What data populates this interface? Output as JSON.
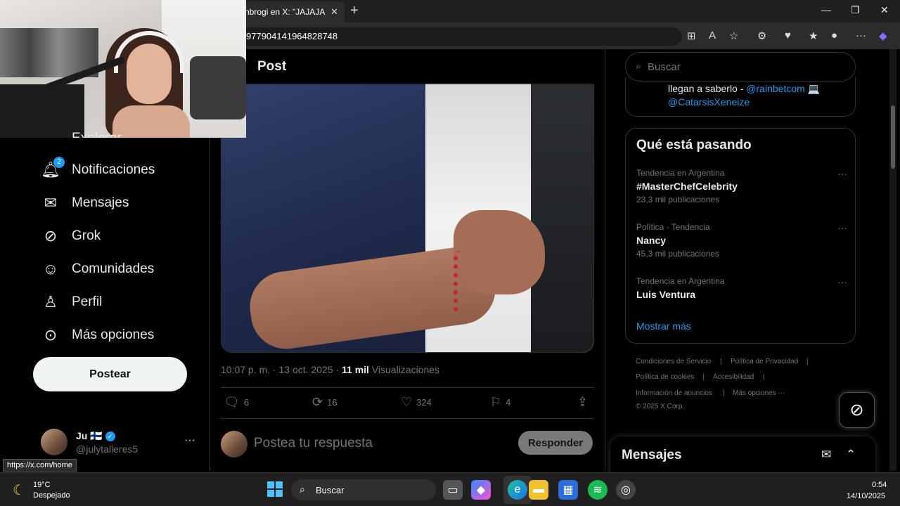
{
  "browser": {
    "tab_title": "nbrogi en X: \"JAJAJA K",
    "url": "977904141964828748"
  },
  "sidebar": {
    "partial_item": "Explorar",
    "items": [
      {
        "label": "Notificaciones",
        "icon": "bell-icon",
        "badge": "2"
      },
      {
        "label": "Mensajes",
        "icon": "mail-icon"
      },
      {
        "label": "Grok",
        "icon": "grok-icon"
      },
      {
        "label": "Comunidades",
        "icon": "communities-icon"
      },
      {
        "label": "Perfil",
        "icon": "profile-icon"
      },
      {
        "label": "Más opciones",
        "icon": "more-options-icon"
      }
    ],
    "post_button": "Postear",
    "user": {
      "name": "Ju 🇫🇮",
      "handle": "@julytalleres5"
    },
    "status_url": "https://x.com/home"
  },
  "post": {
    "header": "Post",
    "time": "10:07 p. m. · 13 oct. 2025 · ",
    "views_count": "11 mil",
    "views_label": " Visualizaciones",
    "actions": {
      "replies": "6",
      "reposts": "16",
      "likes": "324",
      "bookmarks": "4"
    },
    "reply_placeholder": "Postea tu respuesta",
    "reply_button": "Responder"
  },
  "right": {
    "search_placeholder": "Buscar",
    "promo_line1": "llegan a saberlo - ",
    "promo_link1": "@rainbetcom",
    "promo_emoji": " 💻",
    "promo_link2": "@CatarsisXeneize",
    "trends_title": "Qué está pasando",
    "trends": [
      {
        "context": "Tendencia en Argentina",
        "name": "#MasterChefCelebrity",
        "count": "23,3 mil publicaciones"
      },
      {
        "context": "Política · Tendencia",
        "name": "Nancy",
        "count": "45,3 mil publicaciones"
      },
      {
        "context": "Tendencia en Argentina",
        "name": "Luis Ventura",
        "count": ""
      }
    ],
    "show_more": "Mostrar más",
    "footer": {
      "terms": "Condiciones de Servicio",
      "privacy": "Política de Privacidad",
      "cookies": "Política de cookies",
      "accessibility": "Accesibilidad",
      "ads": "Información de anuncios",
      "more": "Más opciones ···",
      "copyright": "© 2025 X Corp."
    },
    "messages_title": "Mensajes"
  },
  "taskbar": {
    "temp": "19°C",
    "weather": "Despejado",
    "search": "Buscar",
    "time": "0:54",
    "date": "14/10/2025"
  }
}
